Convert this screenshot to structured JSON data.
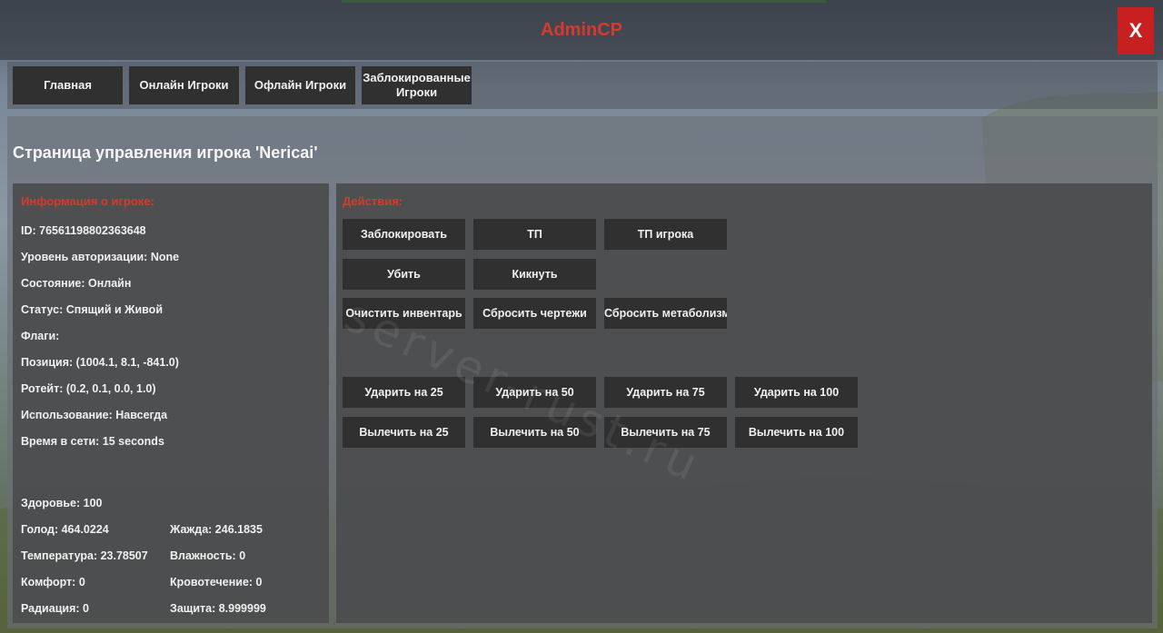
{
  "colors": {
    "accent_red": "#d63a2c",
    "close_bg": "#c82020",
    "button_bg": "#303030",
    "progress": "#3fa436",
    "progress_track": "#3a6a8c"
  },
  "titlebar": {
    "title": "AdminCP",
    "close_label": "X"
  },
  "nav": {
    "tabs": [
      {
        "label": "Главная"
      },
      {
        "label": "Онлайн Игроки"
      },
      {
        "label": "Офлайн Игроки"
      },
      {
        "label": "Заблокированные Игроки"
      }
    ]
  },
  "page": {
    "title": "Страница управления игрока 'Nericai'"
  },
  "info": {
    "header": "Информация о игроке:",
    "lines": [
      "ID: 76561198802363648",
      "Уровень авторизации: None",
      "Состояние: Онлайн",
      "Статус: Спящий и Живой",
      "Флаги:",
      "Позиция: (1004.1, 8.1, -841.0)",
      "Ротейт: (0.2, 0.1, 0.0, 1.0)",
      "Использование: Навсегда",
      "Время в сети: 15 seconds"
    ],
    "stats": [
      "Здоровье: 100",
      "Голод: 464.0224",
      "Жажда: 246.1835",
      "Температура: 23.78507",
      "Влажность: 0",
      "Комфорт: 0",
      "Кровотечение: 0",
      "Радиация: 0",
      "Защита: 8.999999"
    ]
  },
  "actions": {
    "header": "Действия:",
    "row1": [
      "Заблокировать",
      "ТП",
      "ТП игрока"
    ],
    "row2": [
      "Убить",
      "Кикнуть"
    ],
    "row3": [
      "Очистить инвентарь",
      "Сбросить чертежи",
      "Сбросить метаболизм"
    ],
    "hit": [
      "Ударить на 25",
      "Ударить на 50",
      "Ударить на 75",
      "Ударить на 100"
    ],
    "heal": [
      "Вылечить на 25",
      "Вылечить на 50",
      "Вылечить на 75",
      "Вылечить на 100"
    ]
  },
  "watermark": "server-rust.ru"
}
